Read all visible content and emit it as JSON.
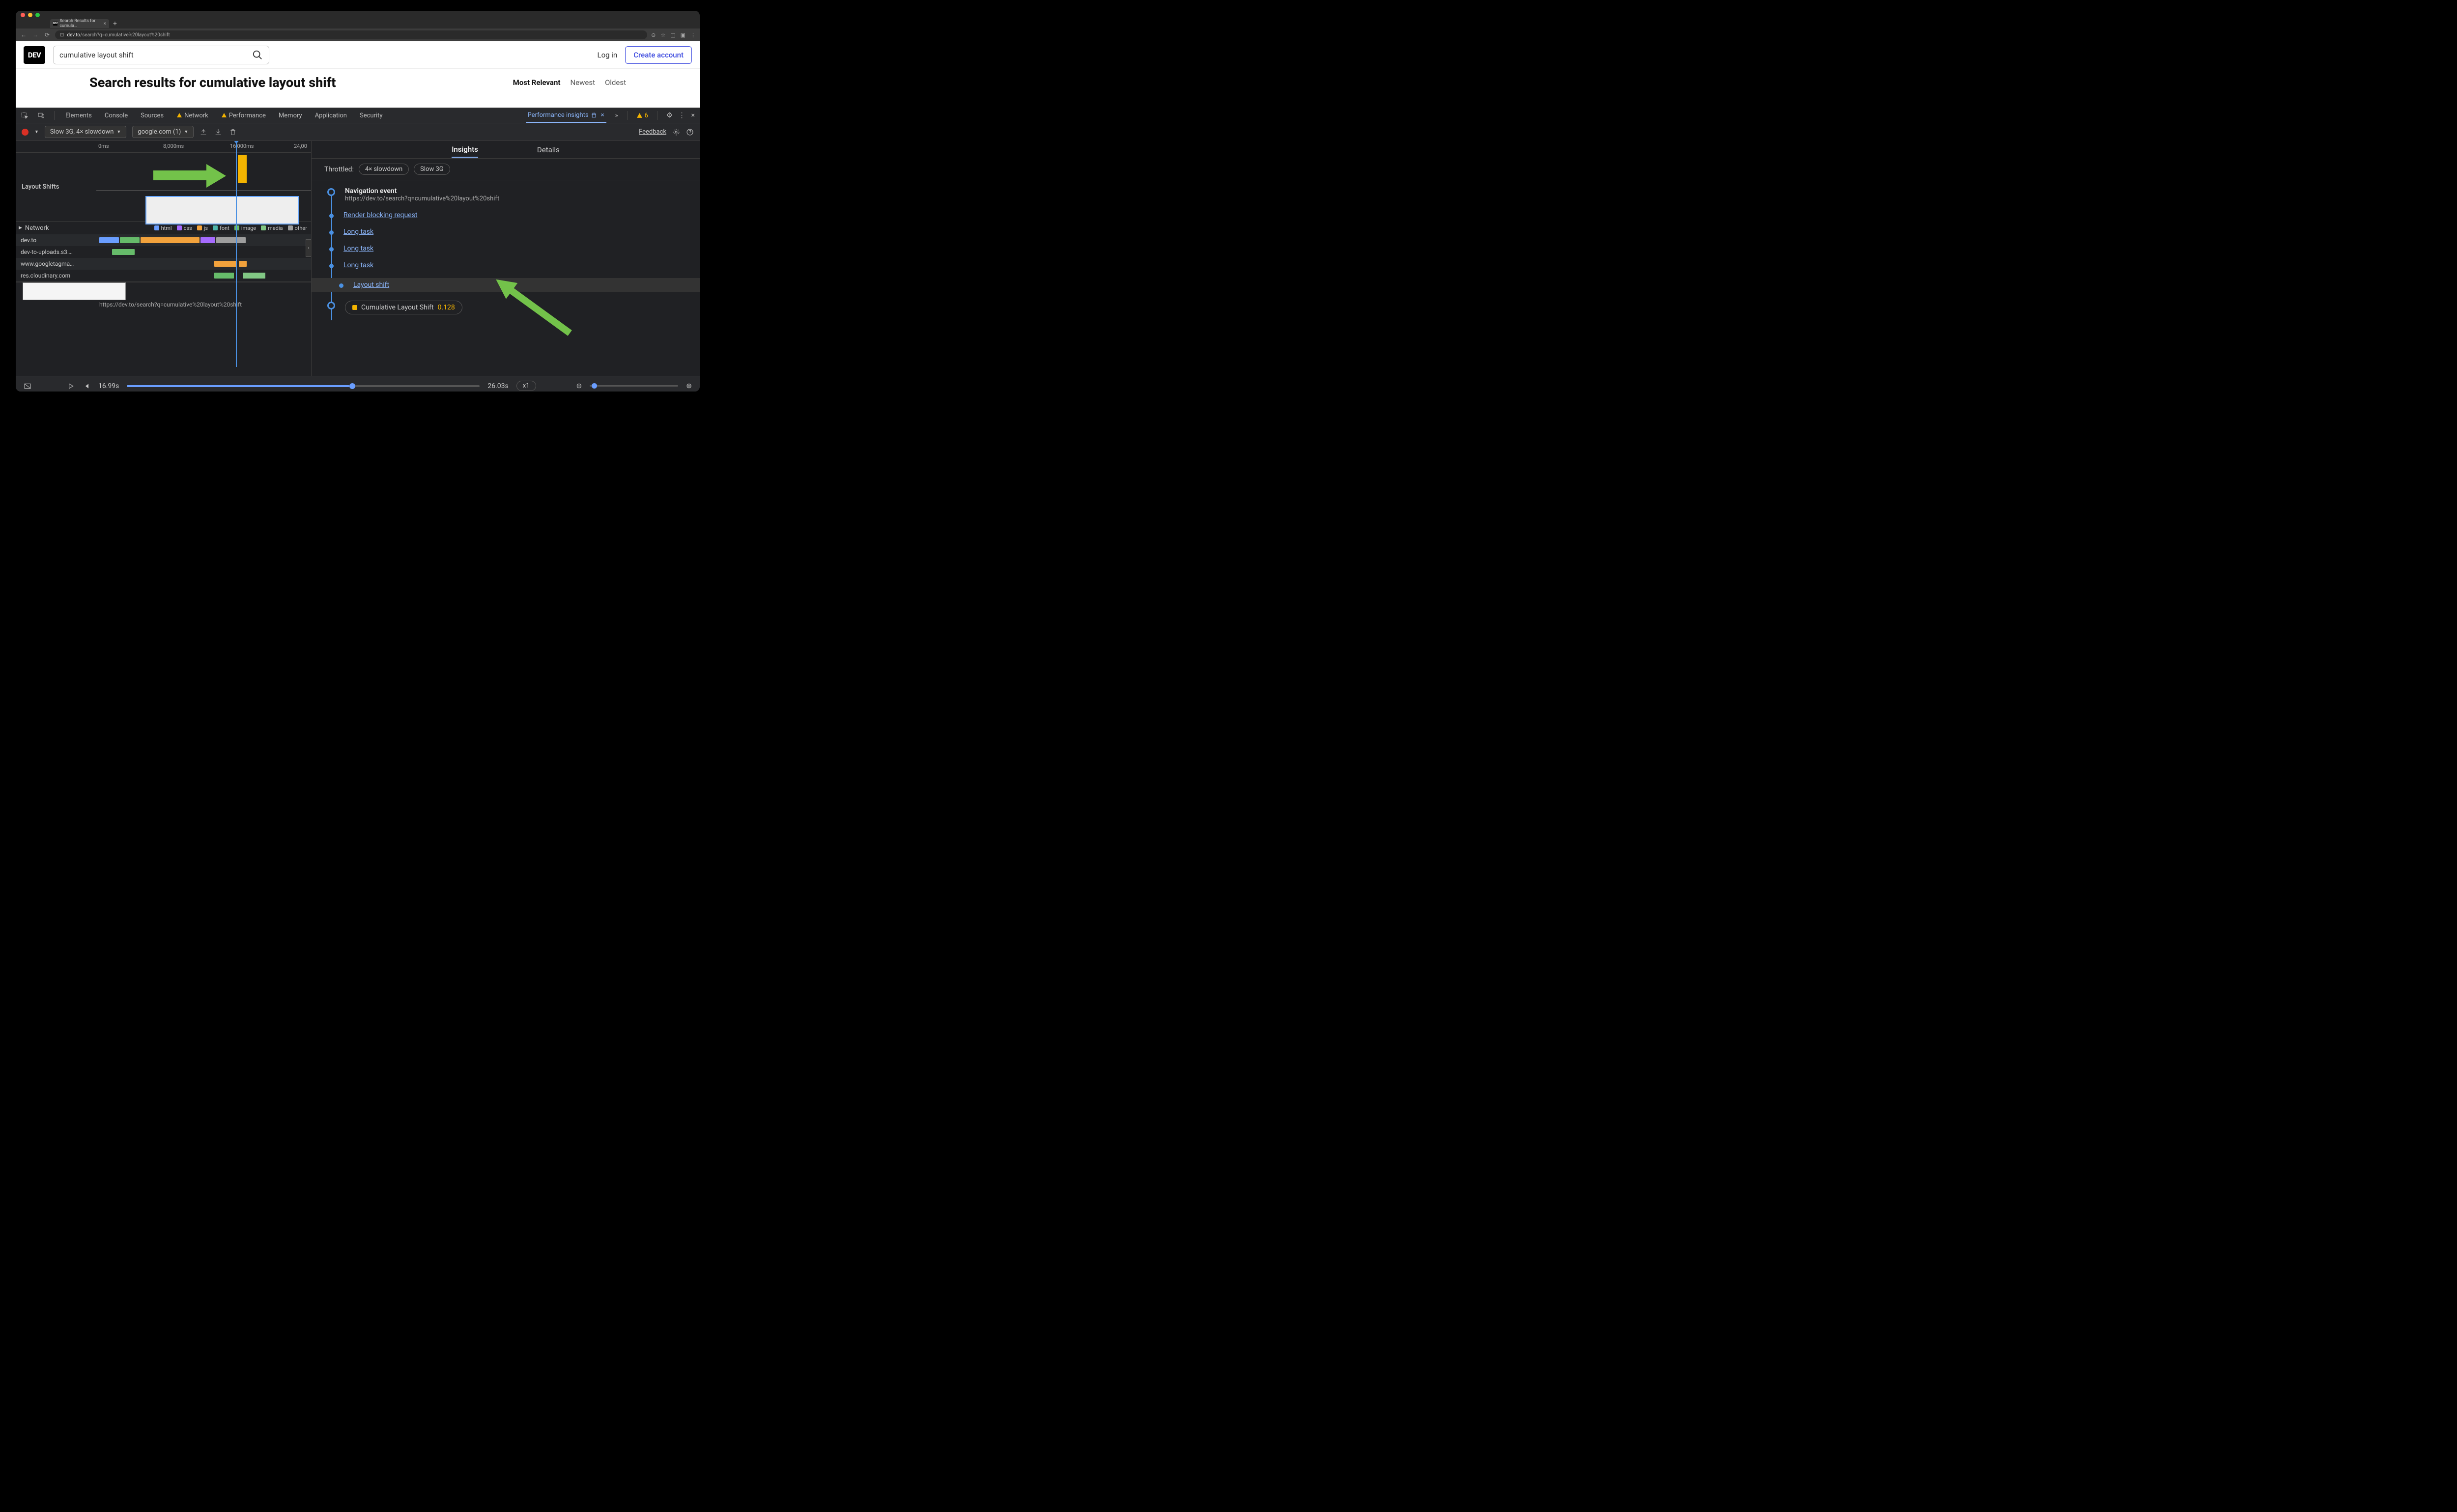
{
  "browser": {
    "tab_title": "Search Results for cumula…",
    "url_display": "dev.to/search?q=cumulative%20layout%20shift",
    "url_domain": "dev.to"
  },
  "page": {
    "logo": "DEV",
    "search_value": "cumulative layout shift",
    "login": "Log in",
    "create": "Create account",
    "results_title": "Search results for cumulative layout shift",
    "sort": {
      "relevant": "Most Relevant",
      "newest": "Newest",
      "oldest": "Oldest"
    }
  },
  "devtools": {
    "tabs": {
      "elements": "Elements",
      "console": "Console",
      "sources": "Sources",
      "network": "Network",
      "performance": "Performance",
      "memory": "Memory",
      "application": "Application",
      "security": "Security",
      "perf_insights": "Performance insights"
    },
    "warnings": "6",
    "toolbar": {
      "throttle": "Slow 3G, 4× slowdown",
      "origin": "google.com (1)",
      "feedback": "Feedback"
    },
    "ruler": {
      "t0": "0ms",
      "t1": "8,000ms",
      "t2": "16,000ms",
      "t3": "24,00"
    },
    "layout_shifts_label": "Layout Shifts",
    "network_label": "Network",
    "legend": {
      "html": "html",
      "css": "css",
      "js": "js",
      "font": "font",
      "image": "image",
      "media": "media",
      "other": "other"
    },
    "net_rows": {
      "r0": "dev.to",
      "r1": "dev-to-uploads.s3….",
      "r2": "www.googletagma…",
      "r3": "res.cloudinary.com"
    },
    "renderer_url": "https://dev.to/search?q=cumulative%20layout%20shift",
    "insights": {
      "tab_insights": "Insights",
      "tab_details": "Details",
      "throttled_label": "Throttled:",
      "chip_cpu": "4× slowdown",
      "chip_net": "Slow 3G",
      "nav_title": "Navigation event",
      "nav_url": "https://dev.to/search?q=cumulative%20layout%20shift",
      "render_block": "Render blocking request",
      "long_task": "Long task",
      "layout_shift": "Layout shift",
      "cls_label": "Cumulative Layout Shift",
      "cls_value": "0.128"
    },
    "footer": {
      "time_current": "16.99s",
      "time_total": "26.03s",
      "speed": "x1"
    }
  }
}
